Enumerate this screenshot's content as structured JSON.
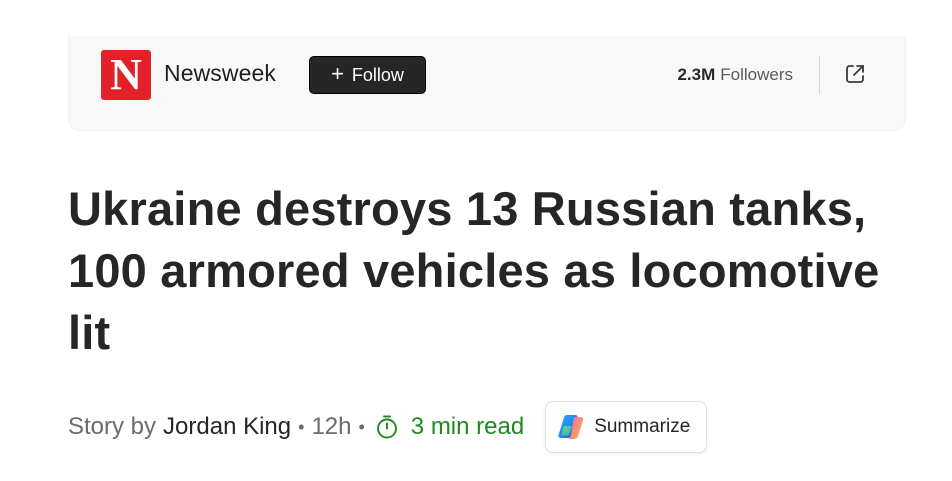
{
  "publisher": {
    "logo_letter": "N",
    "name": "Newsweek",
    "follow_label": "Follow",
    "follow_symbol": "+",
    "followers_count": "2.3M",
    "followers_label": "Followers",
    "brand_color": "#e32129"
  },
  "article": {
    "headline": "Ukraine destroys 13 Russian tanks, 100 armored vehicles as locomotive lit"
  },
  "byline": {
    "prefix": "Story by",
    "author": "Jordan King",
    "separator": "•",
    "time_ago": "12h",
    "read_time": "3 min read",
    "read_time_color": "#1f8a1f"
  },
  "actions": {
    "summarize_label": "Summarize"
  },
  "icons": {
    "share": "external-share-icon",
    "timer": "stopwatch-icon",
    "copilot": "copilot-icon"
  }
}
